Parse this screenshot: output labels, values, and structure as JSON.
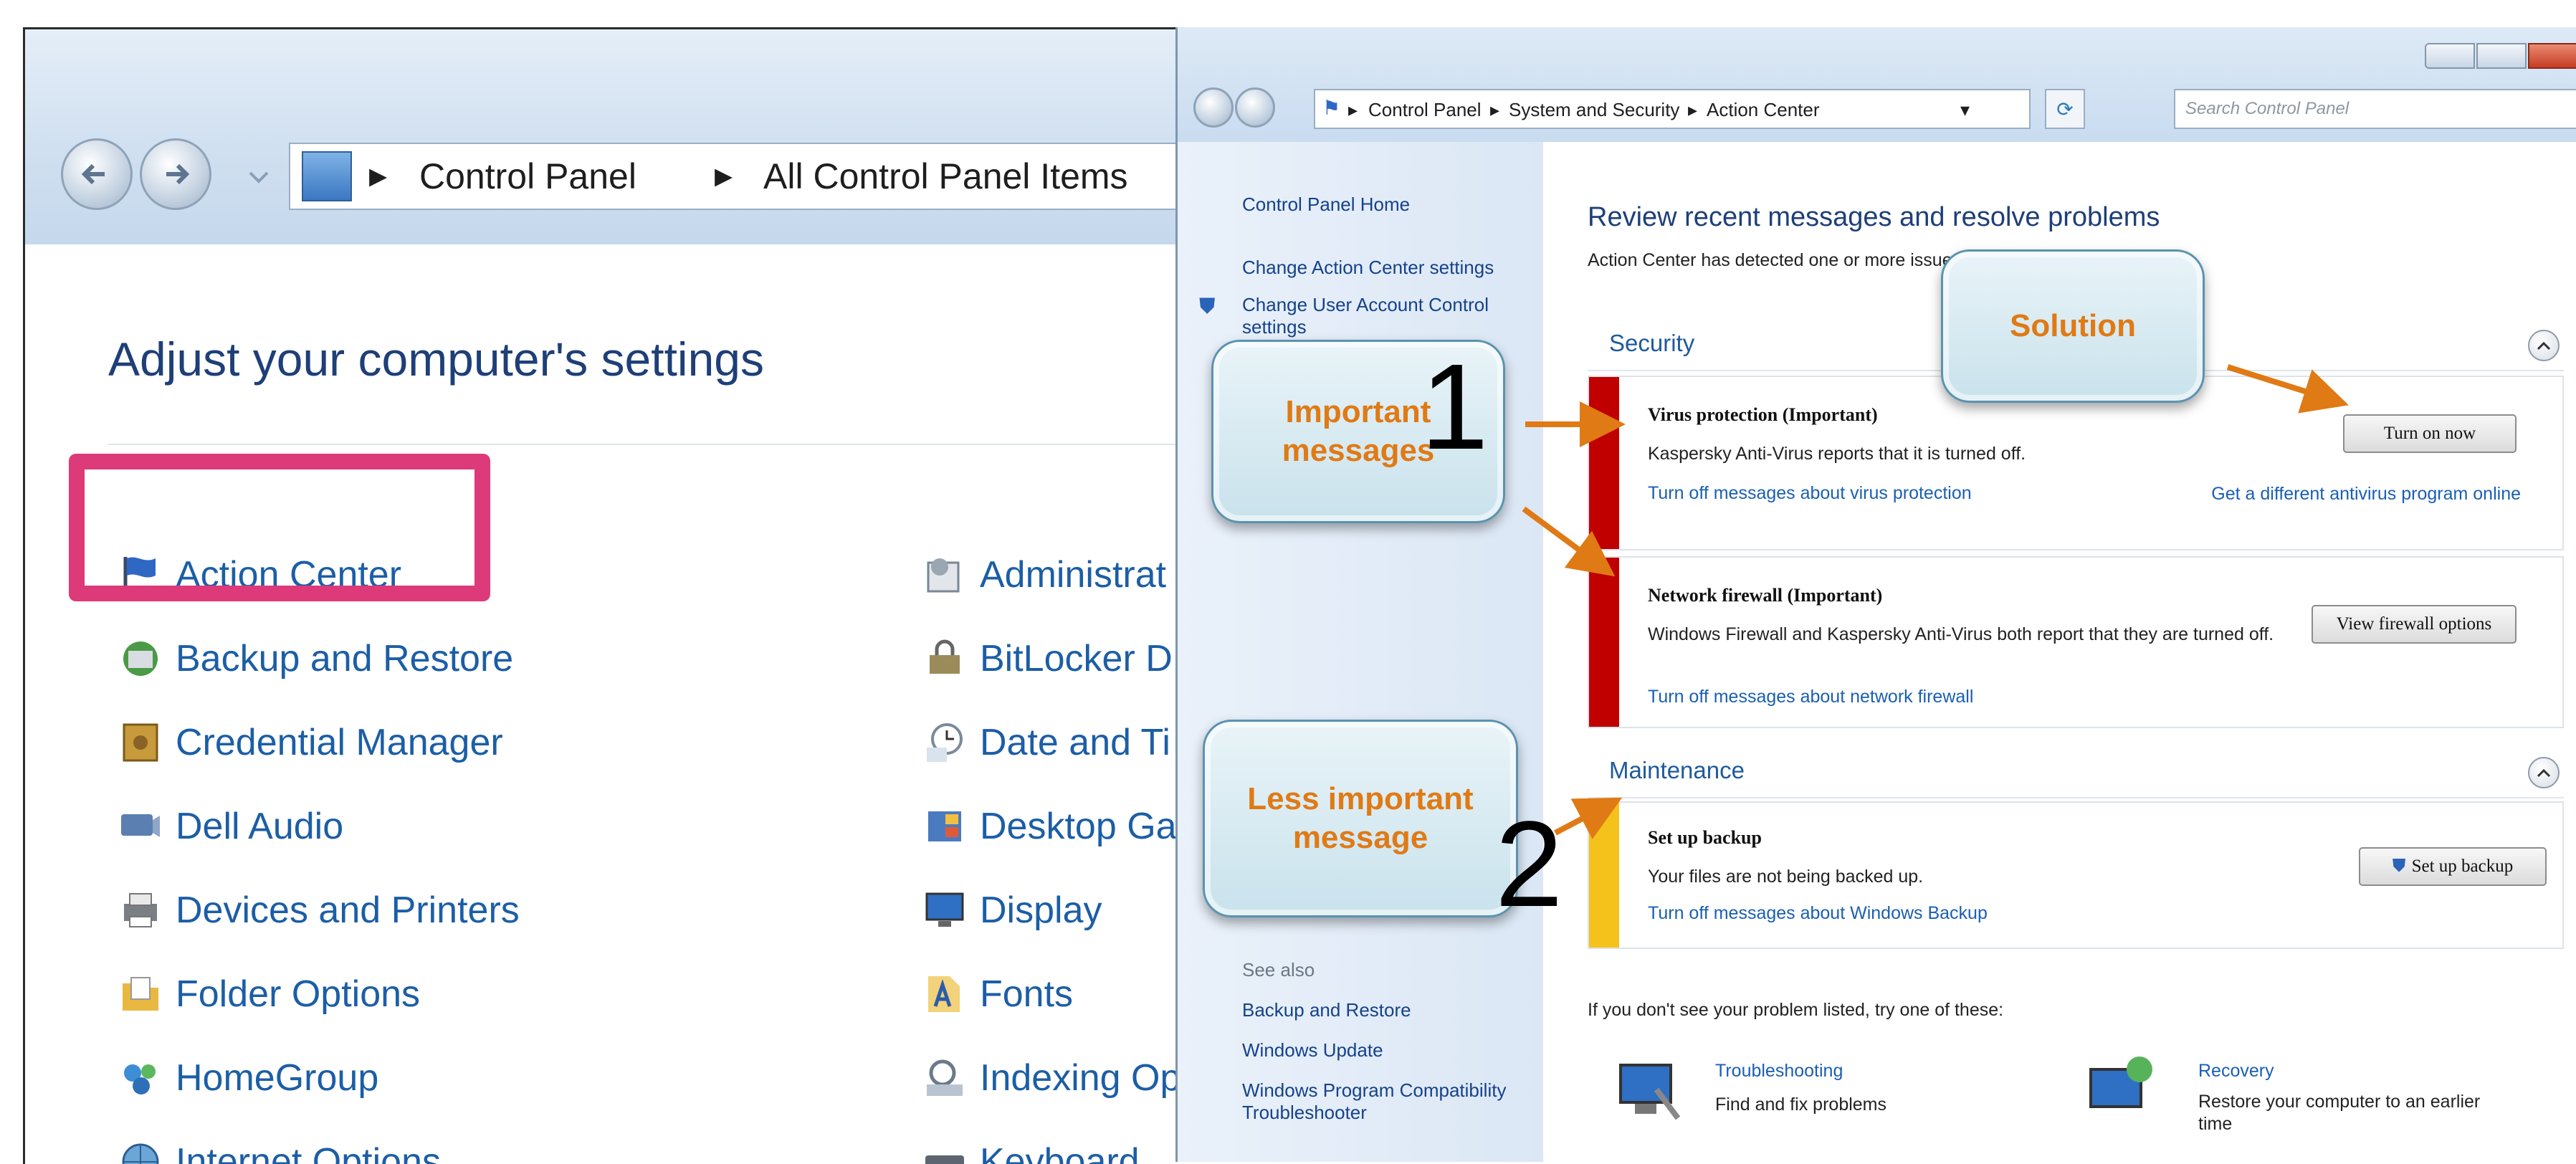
{
  "back_window": {
    "breadcrumbs": [
      "Control Panel",
      "All Control Panel Items"
    ],
    "heading": "Adjust your computer's settings",
    "items_col1": [
      "Action Center",
      "Backup and Restore",
      "Credential Manager",
      "Dell Audio",
      "Devices and Printers",
      "Folder Options",
      "HomeGroup",
      "Internet Options"
    ],
    "items_col2": [
      "Administrat",
      "BitLocker D",
      "Date and Ti",
      "Desktop Ga",
      "Display",
      "Fonts",
      "Indexing Op",
      "Keyboard"
    ],
    "icons_col1": [
      "flag-icon",
      "backup-icon",
      "vault-icon",
      "speaker-icon",
      "printer-icon",
      "folder-icon",
      "homegroup-icon",
      "globe-icon"
    ],
    "icons_col2": [
      "admin-tools-icon",
      "bitlocker-icon",
      "clock-icon",
      "gadgets-icon",
      "monitor-icon",
      "fonts-icon",
      "indexing-icon",
      "keyboard-icon"
    ],
    "highlight_color": "#dc3a78"
  },
  "front_window": {
    "breadcrumbs": [
      "Control Panel",
      "System and Security",
      "Action Center"
    ],
    "search_placeholder": "Search Control Panel",
    "left_nav": {
      "home": "Control Panel Home",
      "change_settings": "Change Action Center settings",
      "change_uac": "Change User Account Control settings",
      "see_also_label": "See also",
      "see_also": [
        "Backup and Restore",
        "Windows Update",
        "Windows Program Compatibility Troubleshooter"
      ]
    },
    "main": {
      "title": "Review recent messages and resolve problems",
      "subtitle": "Action Center has detected one or more issues for you to review.",
      "security_header": "Security",
      "maintenance_header": "Maintenance",
      "virus": {
        "title": "Virus protection  (Important)",
        "text": "Kaspersky Anti-Virus reports that it is turned off.",
        "link": "Turn off messages about virus protection",
        "button": "Turn on now",
        "alt_link": "Get a different antivirus program online"
      },
      "firewall": {
        "title": "Network firewall  (Important)",
        "text": "Windows Firewall and Kaspersky Anti-Virus both report that they are turned off.",
        "link": "Turn off messages about network firewall",
        "button": "View firewall options"
      },
      "backup": {
        "title": "Set up backup",
        "text": "Your files are not being backed up.",
        "link": "Turn off messages about Windows Backup",
        "button": "Set up backup"
      },
      "footer_text": "If you don't see your problem listed, try one of these:",
      "troubleshooting": {
        "title": "Troubleshooting",
        "text": "Find and fix problems"
      },
      "recovery": {
        "title": "Recovery",
        "text": "Restore your computer to an earlier time"
      }
    },
    "colors": {
      "important_bar": "#c00000",
      "less_important_bar": "#f5c21b",
      "link": "#1a5fb4"
    }
  },
  "annotations": {
    "callout_important": "Important messages",
    "callout_solution": "Solution",
    "callout_less_important": "Less important message",
    "number_1": "1",
    "number_2": "2",
    "arrow_color": "#e07a15"
  }
}
